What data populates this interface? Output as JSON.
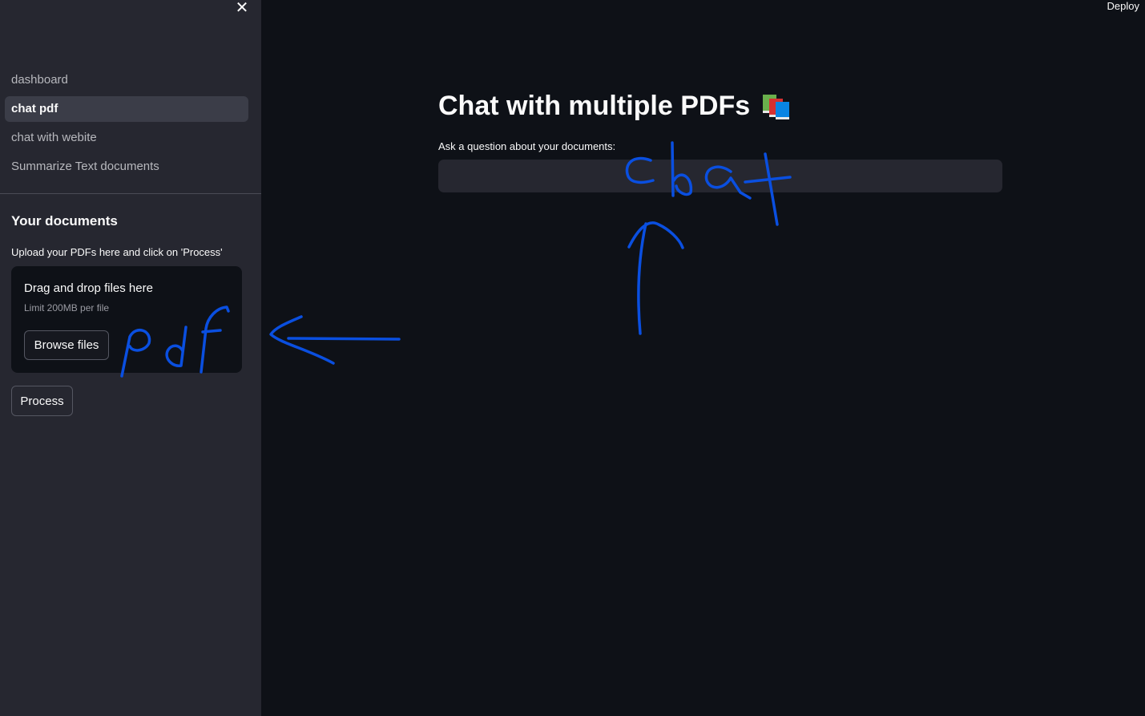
{
  "sidebar": {
    "nav": [
      {
        "label": "dashboard",
        "active": false
      },
      {
        "label": "chat pdf",
        "active": true
      },
      {
        "label": "chat with webite",
        "active": false
      },
      {
        "label": "Summarize Text documents",
        "active": false
      }
    ],
    "heading": "Your documents",
    "caption": "Upload your PDFs here and click on 'Process'",
    "uploader": {
      "title": "Drag and drop files here",
      "limit": "Limit 200MB per file",
      "browse_label": "Browse files"
    },
    "process_label": "Process",
    "close_icon": "close-icon"
  },
  "header": {
    "deploy_label": "Deploy"
  },
  "main": {
    "title": "Chat with multiple PDFs",
    "title_icon": "books-icon",
    "question_label": "Ask a question about your documents:",
    "question_value": ""
  },
  "annotations": {
    "chat_word": "chat",
    "pdf_word": "pdf",
    "color": "#0a4fe0"
  }
}
